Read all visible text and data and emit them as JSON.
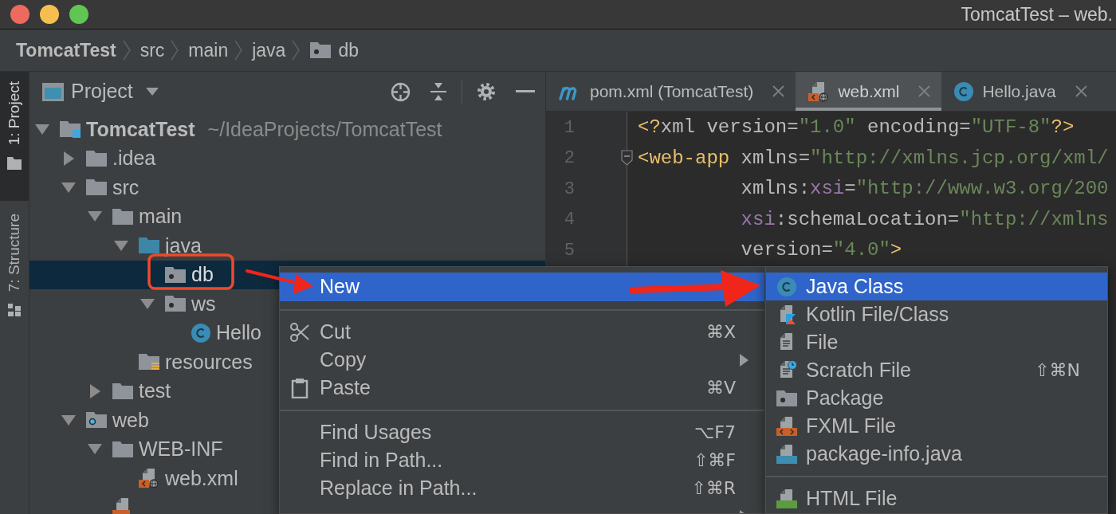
{
  "window": {
    "title": "TomcatTest – web."
  },
  "breadcrumbs": [
    {
      "label": "TomcatTest",
      "kind": "project"
    },
    {
      "label": "src",
      "kind": "folder"
    },
    {
      "label": "main",
      "kind": "folder"
    },
    {
      "label": "java",
      "kind": "folder"
    },
    {
      "label": "db",
      "kind": "package"
    }
  ],
  "tool_stripe": [
    {
      "label": "1: Project",
      "kind": "project",
      "selected": true
    },
    {
      "label": "7: Structure",
      "kind": "structure",
      "selected": false
    }
  ],
  "project_panel": {
    "title": "Project",
    "tree": [
      {
        "label": "TomcatTest",
        "hint": "~/IdeaProjects/TomcatTest",
        "kind": "project",
        "expanded": true,
        "selected": false,
        "children": [
          {
            "label": ".idea",
            "kind": "folder",
            "expanded": false,
            "selected": false
          },
          {
            "label": "src",
            "kind": "folder",
            "expanded": true,
            "selected": false,
            "children": [
              {
                "label": "main",
                "kind": "folder",
                "expanded": true,
                "selected": false,
                "children": [
                  {
                    "label": "java",
                    "kind": "source",
                    "expanded": true,
                    "selected": false,
                    "children": [
                      {
                        "label": "db",
                        "kind": "package",
                        "selected": true
                      },
                      {
                        "label": "ws",
                        "kind": "package",
                        "expanded": true,
                        "selected": false,
                        "children": [
                          {
                            "label": "Hello",
                            "kind": "class",
                            "selected": false
                          }
                        ]
                      }
                    ]
                  },
                  {
                    "label": "resources",
                    "kind": "resources",
                    "selected": false
                  }
                ]
              },
              {
                "label": "test",
                "kind": "folder",
                "expanded": false,
                "selected": false
              }
            ]
          },
          {
            "label": "web",
            "kind": "web",
            "expanded": true,
            "selected": false,
            "children": [
              {
                "label": "WEB-INF",
                "kind": "folder",
                "expanded": true,
                "selected": false,
                "children": [
                  {
                    "label": "web.xml",
                    "kind": "xml",
                    "selected": false
                  }
                ]
              },
              {
                "kind": "jsp",
                "selected": false
              }
            ]
          }
        ]
      }
    ]
  },
  "editor": {
    "tabs": [
      {
        "label": "pom.xml (TomcatTest)",
        "kind": "maven",
        "selected": false
      },
      {
        "label": "web.xml",
        "kind": "xml",
        "selected": true
      },
      {
        "label": "Hello.java",
        "kind": "class",
        "selected": false
      }
    ],
    "lines": [
      {
        "number": "1",
        "fold": false,
        "tokens": [
          {
            "kind": "tag",
            "text": "<?"
          },
          {
            "kind": "attr",
            "text": "xml version="
          },
          {
            "kind": "value",
            "text": "\"1.0\""
          },
          {
            "kind": "attr",
            "text": " encoding="
          },
          {
            "kind": "value",
            "text": "\"UTF-8\""
          },
          {
            "kind": "tag",
            "text": "?>"
          }
        ]
      },
      {
        "number": "2",
        "fold": true,
        "tokens": [
          {
            "kind": "tag",
            "text": "<web-app"
          },
          {
            "kind": "attr",
            "text": " xmlns="
          },
          {
            "kind": "value",
            "text": "\"http://xmlns.jcp.org/xml/"
          }
        ]
      },
      {
        "number": "3",
        "fold": false,
        "tokens": [
          {
            "kind": "attr",
            "text": "         xmlns:"
          },
          {
            "kind": "ns",
            "text": "xsi"
          },
          {
            "kind": "attr",
            "text": "="
          },
          {
            "kind": "value",
            "text": "\"http://www.w3.org/200"
          }
        ]
      },
      {
        "number": "4",
        "fold": false,
        "tokens": [
          {
            "kind": "ns",
            "text": "         xsi"
          },
          {
            "kind": "attr",
            "text": ":schemaLocation="
          },
          {
            "kind": "value",
            "text": "\"http://xmlns"
          }
        ]
      },
      {
        "number": "5",
        "fold": false,
        "tokens": [
          {
            "kind": "attr",
            "text": "         version="
          },
          {
            "kind": "value",
            "text": "\"4.0\""
          },
          {
            "kind": "tag",
            "text": ">"
          }
        ]
      }
    ]
  },
  "context_menu": {
    "items": [
      {
        "kind": "plain",
        "label": "New",
        "selected": true,
        "has_submenu": false
      },
      {
        "kind": "separator"
      },
      {
        "kind": "cut",
        "label": "Cut",
        "shortcut": "⌘X",
        "selected": false,
        "has_submenu": false
      },
      {
        "kind": "plain",
        "label": "Copy",
        "selected": false,
        "has_submenu": true
      },
      {
        "kind": "paste",
        "label": "Paste",
        "shortcut": "⌘V",
        "selected": false,
        "has_submenu": false
      },
      {
        "kind": "separator"
      },
      {
        "kind": "plain",
        "label": "Find Usages",
        "shortcut": "⌥F7",
        "selected": false,
        "has_submenu": false
      },
      {
        "kind": "plain",
        "label": "Find in Path...",
        "shortcut": "⇧⌘F",
        "selected": false,
        "has_submenu": false
      },
      {
        "kind": "plain",
        "label": "Replace in Path...",
        "shortcut": "⇧⌘R",
        "selected": false,
        "has_submenu": false
      },
      {
        "kind": "plain",
        "selected": false,
        "has_submenu": true
      }
    ]
  },
  "submenu": {
    "items": [
      {
        "kind": "class",
        "label": "Java Class",
        "selected": true
      },
      {
        "kind": "kotlin",
        "label": "Kotlin File/Class",
        "selected": false
      },
      {
        "kind": "file",
        "label": "File",
        "selected": false
      },
      {
        "kind": "scratch",
        "label": "Scratch File",
        "shortcut": "⇧⌘N",
        "selected": false
      },
      {
        "kind": "package",
        "label": "Package",
        "selected": false
      },
      {
        "kind": "fxml",
        "label": "FXML File",
        "selected": false
      },
      {
        "kind": "package-info",
        "label": "package-info.java",
        "selected": false
      },
      {
        "kind": "separator"
      },
      {
        "kind": "html",
        "label": "HTML File",
        "selected": false
      }
    ]
  }
}
